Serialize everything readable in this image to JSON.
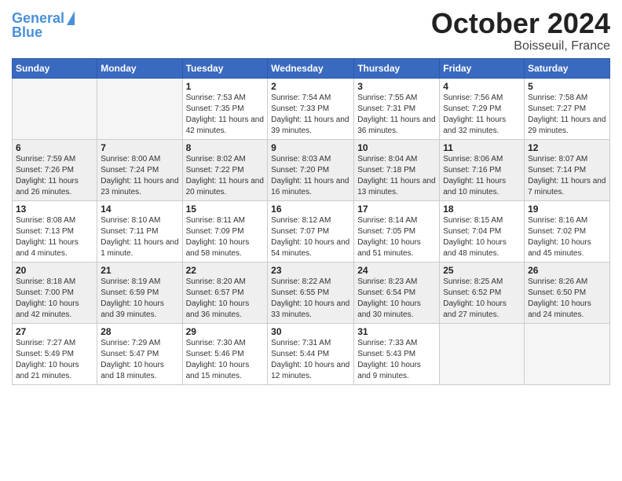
{
  "header": {
    "logo_line1": "General",
    "logo_line2": "Blue",
    "month": "October 2024",
    "location": "Boisseuil, France"
  },
  "days_of_week": [
    "Sunday",
    "Monday",
    "Tuesday",
    "Wednesday",
    "Thursday",
    "Friday",
    "Saturday"
  ],
  "weeks": [
    [
      {
        "day": "",
        "info": ""
      },
      {
        "day": "",
        "info": ""
      },
      {
        "day": "1",
        "info": "Sunrise: 7:53 AM\nSunset: 7:35 PM\nDaylight: 11 hours and 42 minutes."
      },
      {
        "day": "2",
        "info": "Sunrise: 7:54 AM\nSunset: 7:33 PM\nDaylight: 11 hours and 39 minutes."
      },
      {
        "day": "3",
        "info": "Sunrise: 7:55 AM\nSunset: 7:31 PM\nDaylight: 11 hours and 36 minutes."
      },
      {
        "day": "4",
        "info": "Sunrise: 7:56 AM\nSunset: 7:29 PM\nDaylight: 11 hours and 32 minutes."
      },
      {
        "day": "5",
        "info": "Sunrise: 7:58 AM\nSunset: 7:27 PM\nDaylight: 11 hours and 29 minutes."
      }
    ],
    [
      {
        "day": "6",
        "info": "Sunrise: 7:59 AM\nSunset: 7:26 PM\nDaylight: 11 hours and 26 minutes."
      },
      {
        "day": "7",
        "info": "Sunrise: 8:00 AM\nSunset: 7:24 PM\nDaylight: 11 hours and 23 minutes."
      },
      {
        "day": "8",
        "info": "Sunrise: 8:02 AM\nSunset: 7:22 PM\nDaylight: 11 hours and 20 minutes."
      },
      {
        "day": "9",
        "info": "Sunrise: 8:03 AM\nSunset: 7:20 PM\nDaylight: 11 hours and 16 minutes."
      },
      {
        "day": "10",
        "info": "Sunrise: 8:04 AM\nSunset: 7:18 PM\nDaylight: 11 hours and 13 minutes."
      },
      {
        "day": "11",
        "info": "Sunrise: 8:06 AM\nSunset: 7:16 PM\nDaylight: 11 hours and 10 minutes."
      },
      {
        "day": "12",
        "info": "Sunrise: 8:07 AM\nSunset: 7:14 PM\nDaylight: 11 hours and 7 minutes."
      }
    ],
    [
      {
        "day": "13",
        "info": "Sunrise: 8:08 AM\nSunset: 7:13 PM\nDaylight: 11 hours and 4 minutes."
      },
      {
        "day": "14",
        "info": "Sunrise: 8:10 AM\nSunset: 7:11 PM\nDaylight: 11 hours and 1 minute."
      },
      {
        "day": "15",
        "info": "Sunrise: 8:11 AM\nSunset: 7:09 PM\nDaylight: 10 hours and 58 minutes."
      },
      {
        "day": "16",
        "info": "Sunrise: 8:12 AM\nSunset: 7:07 PM\nDaylight: 10 hours and 54 minutes."
      },
      {
        "day": "17",
        "info": "Sunrise: 8:14 AM\nSunset: 7:05 PM\nDaylight: 10 hours and 51 minutes."
      },
      {
        "day": "18",
        "info": "Sunrise: 8:15 AM\nSunset: 7:04 PM\nDaylight: 10 hours and 48 minutes."
      },
      {
        "day": "19",
        "info": "Sunrise: 8:16 AM\nSunset: 7:02 PM\nDaylight: 10 hours and 45 minutes."
      }
    ],
    [
      {
        "day": "20",
        "info": "Sunrise: 8:18 AM\nSunset: 7:00 PM\nDaylight: 10 hours and 42 minutes."
      },
      {
        "day": "21",
        "info": "Sunrise: 8:19 AM\nSunset: 6:59 PM\nDaylight: 10 hours and 39 minutes."
      },
      {
        "day": "22",
        "info": "Sunrise: 8:20 AM\nSunset: 6:57 PM\nDaylight: 10 hours and 36 minutes."
      },
      {
        "day": "23",
        "info": "Sunrise: 8:22 AM\nSunset: 6:55 PM\nDaylight: 10 hours and 33 minutes."
      },
      {
        "day": "24",
        "info": "Sunrise: 8:23 AM\nSunset: 6:54 PM\nDaylight: 10 hours and 30 minutes."
      },
      {
        "day": "25",
        "info": "Sunrise: 8:25 AM\nSunset: 6:52 PM\nDaylight: 10 hours and 27 minutes."
      },
      {
        "day": "26",
        "info": "Sunrise: 8:26 AM\nSunset: 6:50 PM\nDaylight: 10 hours and 24 minutes."
      }
    ],
    [
      {
        "day": "27",
        "info": "Sunrise: 7:27 AM\nSunset: 5:49 PM\nDaylight: 10 hours and 21 minutes."
      },
      {
        "day": "28",
        "info": "Sunrise: 7:29 AM\nSunset: 5:47 PM\nDaylight: 10 hours and 18 minutes."
      },
      {
        "day": "29",
        "info": "Sunrise: 7:30 AM\nSunset: 5:46 PM\nDaylight: 10 hours and 15 minutes."
      },
      {
        "day": "30",
        "info": "Sunrise: 7:31 AM\nSunset: 5:44 PM\nDaylight: 10 hours and 12 minutes."
      },
      {
        "day": "31",
        "info": "Sunrise: 7:33 AM\nSunset: 5:43 PM\nDaylight: 10 hours and 9 minutes."
      },
      {
        "day": "",
        "info": ""
      },
      {
        "day": "",
        "info": ""
      }
    ]
  ]
}
